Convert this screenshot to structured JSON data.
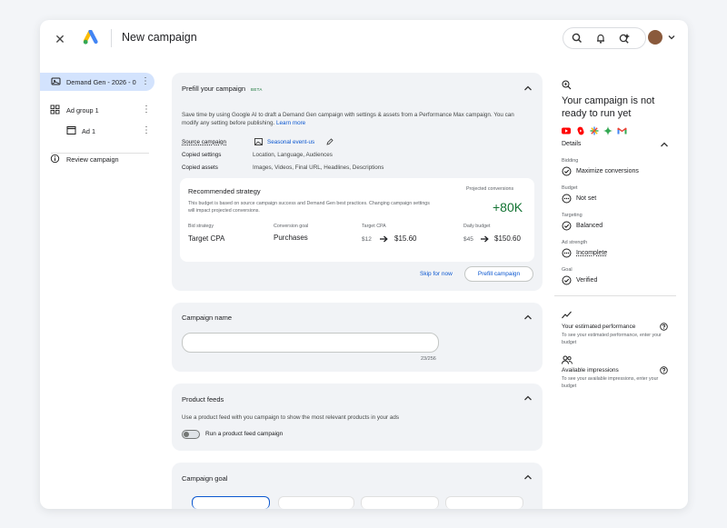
{
  "header": {
    "title": "New campaign"
  },
  "sidebar": {
    "items": [
      {
        "label": "Demand Gen - 2026 - 0",
        "icon": "campaign-icon"
      },
      {
        "label": "Ad group 1",
        "icon": "grid-icon"
      },
      {
        "label": "Ad 1",
        "icon": "ad-window-icon"
      },
      {
        "label": "Review campaign",
        "icon": "info-icon"
      }
    ]
  },
  "prefill": {
    "title": "Prefill your campaign",
    "badge": "BETA",
    "description": "Save time by using Google AI to draft a Demand Gen campaign with settings & assets from a Performance Max campaign. You can modify any setting before publishing.",
    "learn_more": "Learn more",
    "source_label": "Source campaign",
    "source_value": "Seasonal event-us",
    "settings_label": "Copied settings",
    "settings_value": "Location, Language, Audiences",
    "assets_label": "Copied assets",
    "assets_value": "Images, Videos, Final URL, Headlines, Descriptions",
    "strategy": {
      "title": "Recommended strategy",
      "description": "This budget is based on source campaign success and Demand Gen best practices. Changing campaign settings will impact projected conversions.",
      "projected_label": "Projected conversions",
      "projected_value": "+80K",
      "bid_label": "Bid strategy",
      "bid_value": "Target CPA",
      "goal_label": "Conversion goal",
      "goal_value": "Purchases",
      "cpa_label": "Target CPA",
      "cpa_old": "$12",
      "cpa_new": "$15.60",
      "budget_label": "Daily budget",
      "budget_old": "$45",
      "budget_new": "$150.60"
    },
    "skip_label": "Skip for now",
    "prefill_label": "Prefill campaign"
  },
  "campaign_name": {
    "title": "Campaign name",
    "value": "",
    "counter": "23/256"
  },
  "product_feeds": {
    "title": "Product feeds",
    "description": "Use a product feed with you campaign to show the most relevant products in your ads",
    "toggle_label": "Run a product feed campaign",
    "toggle_on": false
  },
  "campaign_goal": {
    "title": "Campaign goal"
  },
  "right_panel": {
    "title": "Your campaign is not ready to run yet",
    "details_label": "Details",
    "channel_icons": [
      "youtube-icon",
      "shorts-icon",
      "discover-icon",
      "gemini-icon",
      "gmail-icon"
    ],
    "details": [
      {
        "label": "Bidding",
        "value": "Maximize conversions",
        "status": "check"
      },
      {
        "label": "Budget",
        "value": "Not set",
        "status": "pending"
      },
      {
        "label": "Targeting",
        "value": "Balanced",
        "status": "check"
      },
      {
        "label": "Ad strength",
        "value": "Incomplete",
        "status": "pending"
      },
      {
        "label": "Goal",
        "value": "Verified",
        "status": "check"
      }
    ],
    "performance_title": "Your estimated performance",
    "performance_sub": "To see your estimated performance, enter your budget",
    "impressions_title": "Available impressions",
    "impressions_sub": "To see your available impressions, enter your budget"
  },
  "colors": {
    "accent": "#0b57d0",
    "active_nav": "#d3e3fd",
    "card_bg": "#f1f3f6",
    "positive": "#137333"
  }
}
